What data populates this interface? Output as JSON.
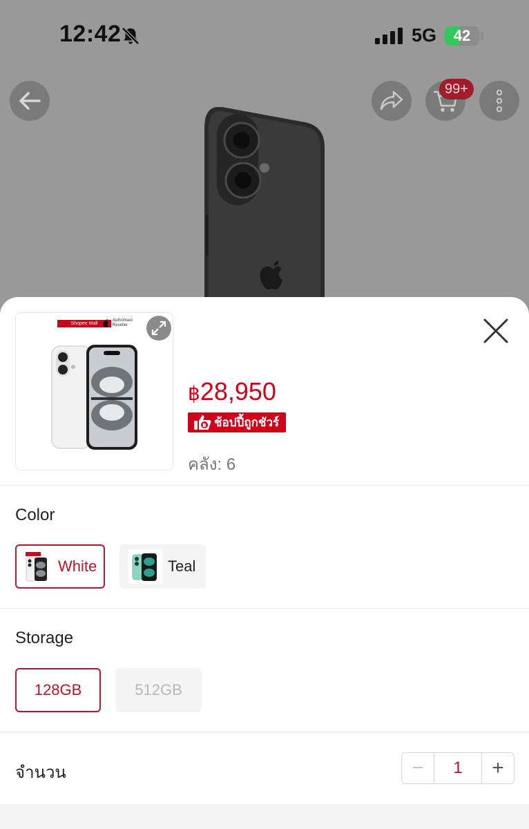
{
  "status_bar": {
    "time": "12:42",
    "network": "5G",
    "battery_percent": "42",
    "battery_level": 0.42,
    "battery_color": "#35c759"
  },
  "nav": {
    "cart_badge": "99+",
    "icons": [
      "back-arrow-icon",
      "share-icon",
      "cart-icon",
      "more-icon"
    ]
  },
  "product": {
    "thumb_tag": "Shopee Mall",
    "thumb_reseller": "Authorised Reseller",
    "price_currency": "฿",
    "price_amount": "28,950",
    "guarantee_label": "ช้อปปี้ถูกชัวร์",
    "stock_label": "คลัง:",
    "stock_value": "6"
  },
  "options": {
    "color": {
      "title": "Color",
      "items": [
        {
          "label": "White",
          "state": "selected"
        },
        {
          "label": "Teal",
          "state": "available"
        }
      ]
    },
    "storage": {
      "title": "Storage",
      "items": [
        {
          "label": "128GB",
          "state": "selected"
        },
        {
          "label": "512GB",
          "state": "disabled"
        }
      ]
    }
  },
  "quantity": {
    "label": "จำนวน",
    "value": "1",
    "minus": "−",
    "plus": "+"
  },
  "colors": {
    "accent": "#d0011b",
    "selected_border": "#b5162a"
  }
}
